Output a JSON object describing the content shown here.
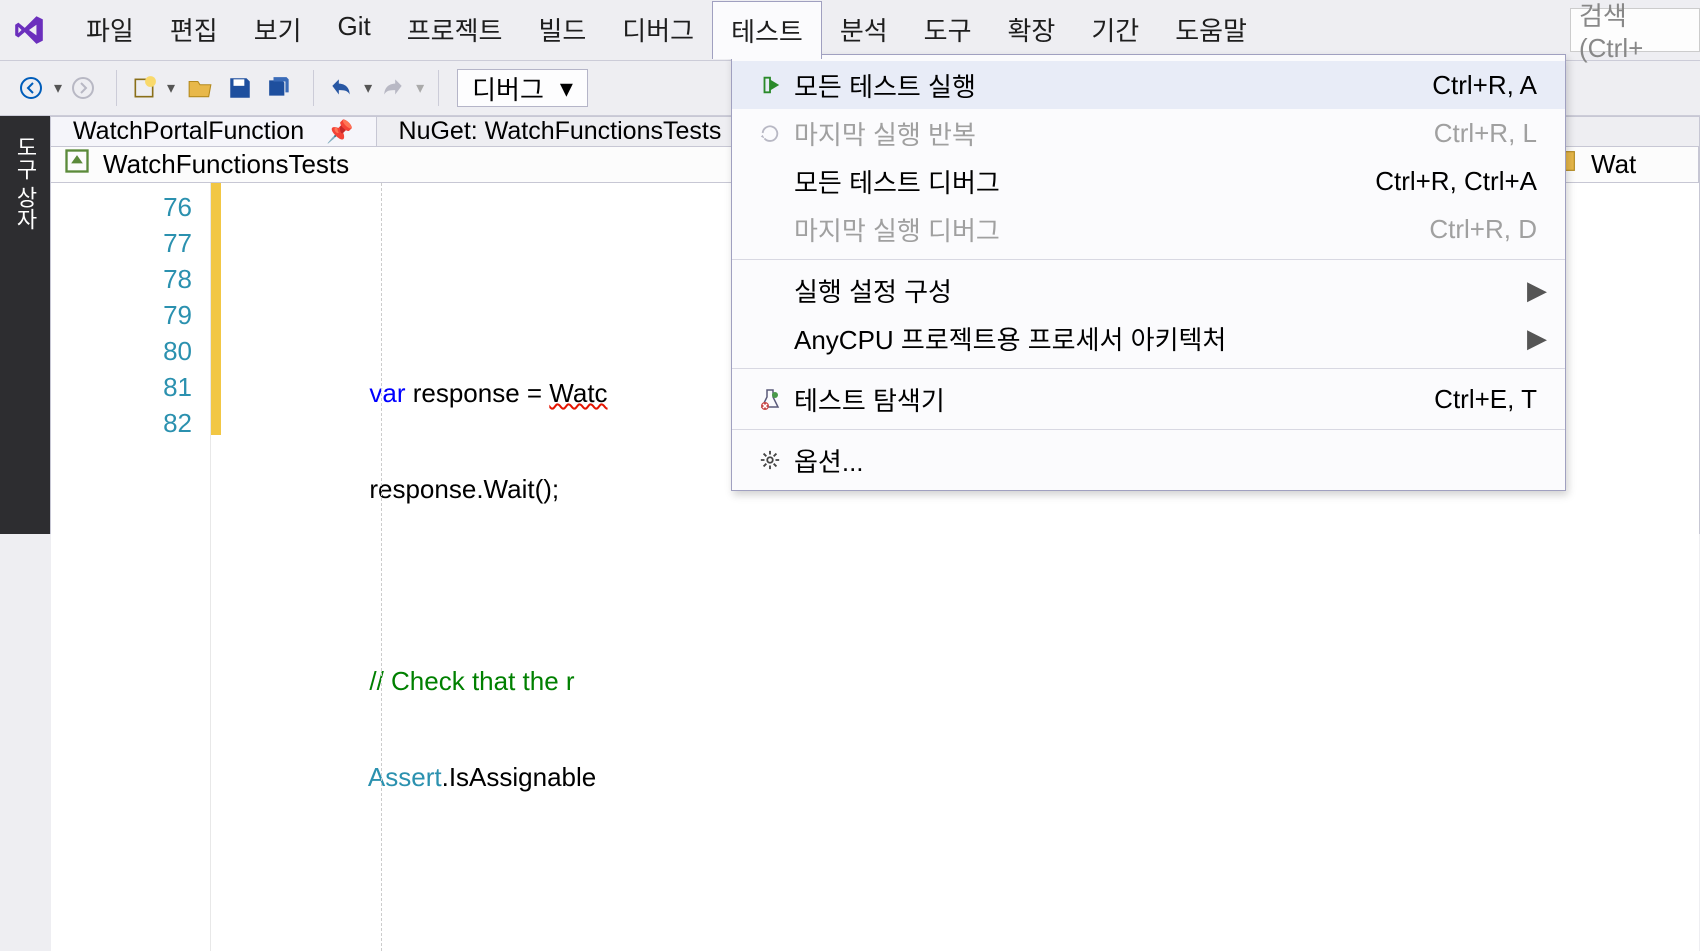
{
  "menubar": {
    "items": [
      "파일",
      "편집",
      "보기",
      "Git",
      "프로젝트",
      "빌드",
      "디버그",
      "테스트",
      "분석",
      "도구",
      "확장",
      "기간",
      "도움말"
    ],
    "active_index": 7,
    "search_placeholder": "검색(Ctrl+"
  },
  "toolbar": {
    "config_label": "디버그"
  },
  "side_panel": {
    "label": "도구 상자"
  },
  "doc_tabs": {
    "tabs": [
      {
        "label": "WatchPortalFunction",
        "pinned": true
      },
      {
        "label": "NuGet: WatchFunctionsTests",
        "pinned": false
      }
    ]
  },
  "nav": {
    "left_label": "WatchFunctionsTests",
    "right_label": "Wat"
  },
  "editor": {
    "line_start": 76,
    "lines": [
      {
        "n": 76,
        "text": ""
      },
      {
        "n": 77,
        "text": "var response = Watc"
      },
      {
        "n": 78,
        "text": "response.Wait();"
      },
      {
        "n": 79,
        "text": ""
      },
      {
        "n": 80,
        "text": "// Check that the r"
      },
      {
        "n": 81,
        "text": "Assert.IsAssignable"
      },
      {
        "n": 82,
        "text": ""
      }
    ]
  },
  "dropdown": {
    "items": [
      {
        "type": "item",
        "icon": "play",
        "label": "모든 테스트 실행",
        "shortcut": "Ctrl+R, A",
        "state": "highlight"
      },
      {
        "type": "item",
        "icon": "repeat",
        "label": "마지막 실행 반복",
        "shortcut": "Ctrl+R, L",
        "state": "disabled"
      },
      {
        "type": "item",
        "icon": "",
        "label": "모든 테스트 디버그",
        "shortcut": "Ctrl+R, Ctrl+A",
        "state": "normal"
      },
      {
        "type": "item",
        "icon": "",
        "label": "마지막 실행 디버그",
        "shortcut": "Ctrl+R, D",
        "state": "disabled"
      },
      {
        "type": "sep"
      },
      {
        "type": "item",
        "icon": "",
        "label": "실행 설정 구성",
        "shortcut": "",
        "submenu": true,
        "state": "normal"
      },
      {
        "type": "item",
        "icon": "",
        "label": "AnyCPU 프로젝트용 프로세서 아키텍처",
        "shortcut": "",
        "submenu": true,
        "state": "normal"
      },
      {
        "type": "sep"
      },
      {
        "type": "item",
        "icon": "flask",
        "label": "테스트 탐색기",
        "shortcut": "Ctrl+E, T",
        "state": "normal"
      },
      {
        "type": "sep"
      },
      {
        "type": "item",
        "icon": "gear",
        "label": "옵션...",
        "shortcut": "",
        "state": "normal"
      }
    ]
  }
}
